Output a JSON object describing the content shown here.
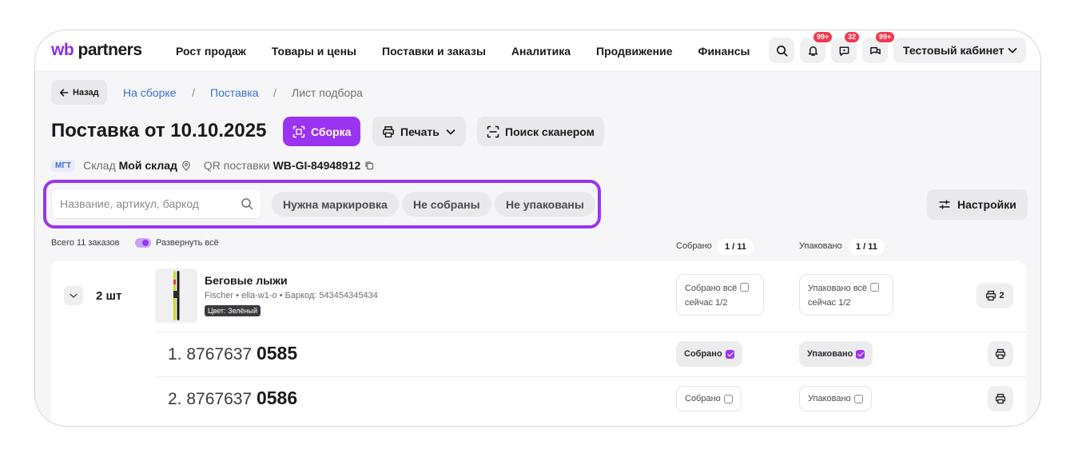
{
  "header": {
    "logo_prefix": "wb",
    "logo_suffix": " partners",
    "nav": [
      "Рост продаж",
      "Товары и цены",
      "Поставки и заказы",
      "Аналитика",
      "Продвижение",
      "Финансы"
    ],
    "badges": {
      "notifications": "99+",
      "feedback": "32",
      "chats": "99+"
    },
    "cabinet_label": "Тестовый кабинет"
  },
  "breadcrumb": {
    "back_label": "Назад",
    "items": [
      "На сборке",
      "Поставка",
      "Лист подбора"
    ],
    "separator": "/"
  },
  "page": {
    "title": "Поставка от 10.10.2025",
    "assembly_button": "Сборка",
    "print_button": "Печать",
    "scanner_button": "Поиск сканером"
  },
  "meta": {
    "tag": "МГТ",
    "warehouse_label": "Склад",
    "warehouse_value": "Мой склад",
    "qr_label": "QR поставки",
    "qr_value": "WB-GI-84948912"
  },
  "filters": {
    "search_placeholder": "Название, артикул, баркод",
    "chips": [
      "Нужна маркировка",
      "Не собраны",
      "Не упакованы"
    ],
    "settings_label": "Настройки"
  },
  "summary": {
    "total_orders": "Всего 11 заказов",
    "expand_all": "Развернуть всё",
    "collected_label": "Собрано",
    "collected_count": "1 / 11",
    "packed_label": "Упаковано",
    "packed_count": "1 / 11"
  },
  "product": {
    "quantity": "2 шт",
    "name": "Беговые лыжи",
    "details": "Fischer • ella-w1-o • Баркод: 543454345434",
    "color_tag": "Цвет: Зелёный",
    "collected_all": "Собрано всё",
    "collected_now": "сейчас 1/2",
    "packed_all": "Упаковано всё",
    "packed_now": "сейчас 1/2",
    "print_count": "2"
  },
  "items": [
    {
      "index": "1.",
      "prefix": "8767637",
      "suffix": "0585",
      "collected_label": "Собрано",
      "packed_label": "Упаковано",
      "collected": true,
      "packed": true
    },
    {
      "index": "2.",
      "prefix": "8767637",
      "suffix": "0586",
      "collected_label": "Собрано",
      "packed_label": "Упаковано",
      "collected": false,
      "packed": false
    }
  ],
  "colors": {
    "accent": "#9a34f0",
    "link": "#3a6ed8",
    "badge": "#f2384d"
  }
}
